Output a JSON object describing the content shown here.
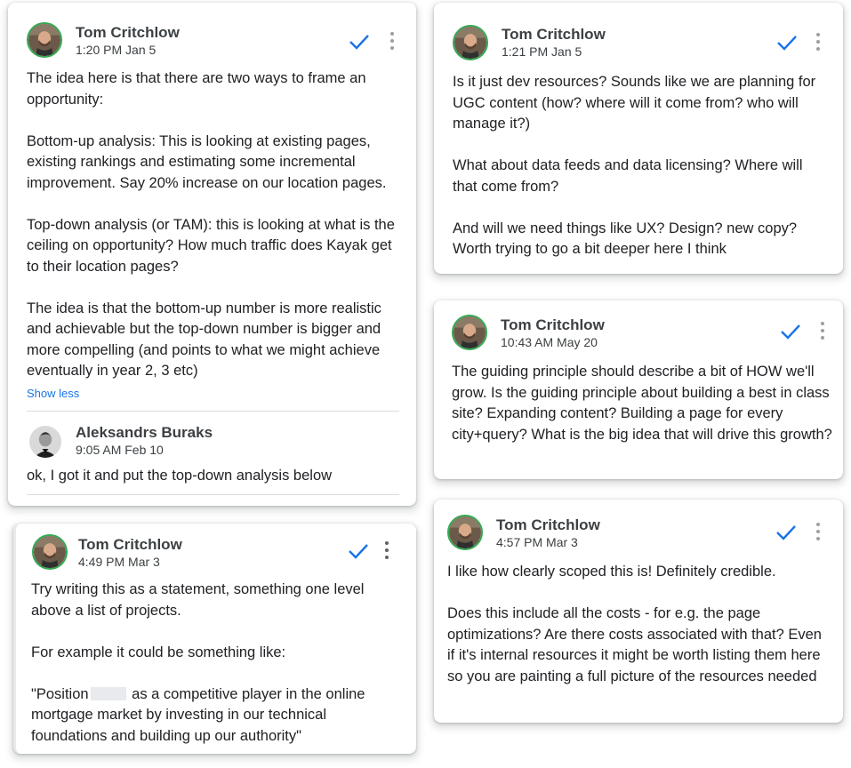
{
  "colors": {
    "check": "#1a73e8",
    "link": "#1a73e8",
    "avatar_ring": "#34a853"
  },
  "cards": [
    {
      "author": "Tom Critchlow",
      "time": "1:20 PM Jan 5",
      "paragraphs": [
        "The idea here is that there are two ways to frame an opportunity:",
        "Bottom-up analysis: This is looking at existing pages, existing rankings and estimating some incremental improvement. Say 20% increase on our location pages.",
        "Top-down analysis (or TAM): this is looking at what is the ceiling on opportunity? How much traffic does Kayak get to their location pages?",
        "The idea is that the bottom-up number is more realistic and achievable but the top-down number is bigger and more compelling (and points to what we might achieve eventually in year 2, 3 etc)"
      ],
      "show_less": "Show less",
      "reply": {
        "author": "Aleksandrs Buraks",
        "time": "9:05 AM Feb 10",
        "text": "ok, I got it and put the top-down analysis below"
      }
    },
    {
      "author": "Tom Critchlow",
      "time": "4:49 PM Mar 3",
      "paragraphs": [
        "Try writing this as a statement, something one level above a list of projects.",
        "For example it could be something like:"
      ],
      "quote_before": "\"Position",
      "quote_after": "as a competitive player in the online mortgage market by investing in our technical foundations and building up our authority\""
    },
    {
      "author": "Tom Critchlow",
      "time": "1:21 PM Jan 5",
      "paragraphs": [
        "Is it just dev resources? Sounds like we are planning for UGC content (how? where will it come from? who will manage it?)",
        "What about data feeds and data licensing? Where will that come from?",
        "And will we need things like UX? Design? new copy? Worth trying to go a bit deeper here I think"
      ]
    },
    {
      "author": "Tom Critchlow",
      "time": "10:43 AM May 20",
      "paragraphs": [
        "The guiding principle should describe a bit of HOW we'll grow. Is the guiding principle about building a best in class site? Expanding content? Building a page for every city+query? What is the big idea that will drive this growth?"
      ]
    },
    {
      "author": "Tom Critchlow",
      "time": "4:57 PM Mar 3",
      "paragraphs": [
        "I like how clearly scoped this is! Definitely credible.",
        "Does this include all the costs - for e.g. the page optimizations? Are there costs associated with that? Even if it's internal resources it might be worth listing them here so you are painting a full picture of the resources needed"
      ]
    }
  ]
}
